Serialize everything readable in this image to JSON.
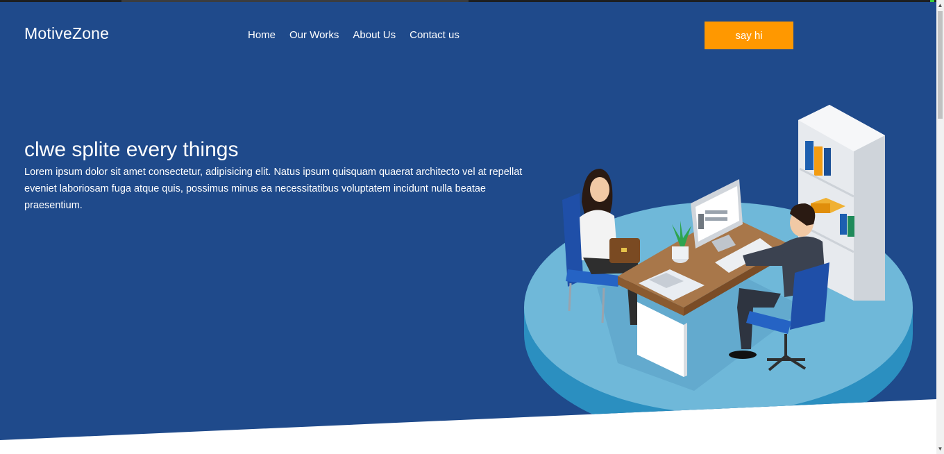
{
  "header": {
    "brand": "MotiveZone",
    "nav": [
      {
        "label": "Home"
      },
      {
        "label": "Our Works"
      },
      {
        "label": "About Us"
      },
      {
        "label": "Contact us"
      }
    ],
    "cta_label": "say hi"
  },
  "hero": {
    "title": "clwe splite every things",
    "body": "Lorem ipsum dolor sit amet consectetur, adipisicing elit. Natus ipsum quisquam quaerat architecto vel at repellat eveniet laboriosam fuga atque quis, possimus minus ea necessitatibus voluptatem incidunt nulla beatae praesentium."
  },
  "colors": {
    "hero_bg": "#1f4a8b",
    "accent": "#ff9800",
    "platform": "#6fb8d9"
  },
  "icons": {
    "scroll_up": "▲",
    "scroll_down": "▼"
  }
}
